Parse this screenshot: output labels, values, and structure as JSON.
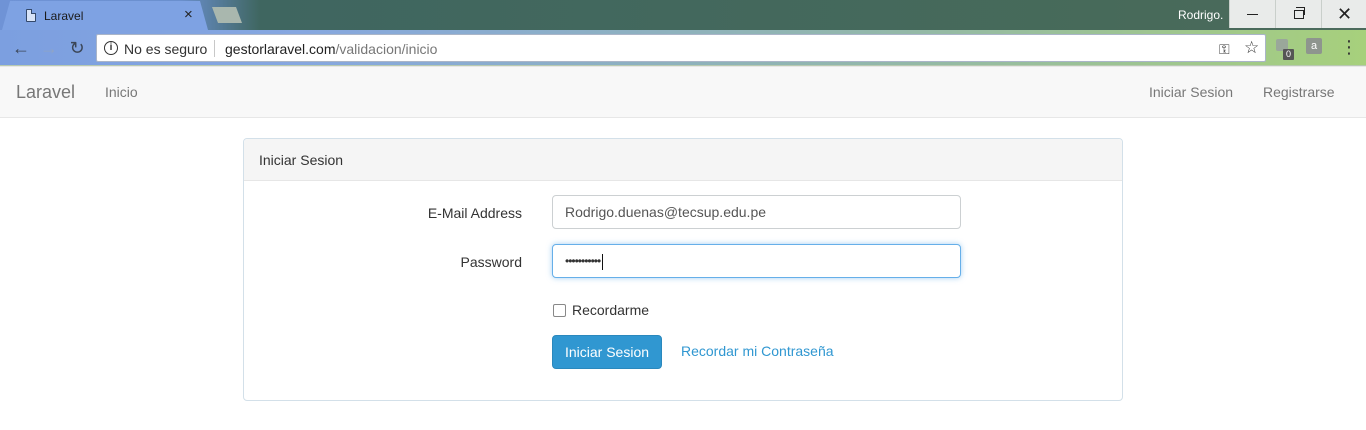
{
  "browser": {
    "tab_title": "Laravel",
    "tab_close": "×",
    "user_name": "Rodrigo.",
    "window_close": "✕",
    "security_text": "No es seguro",
    "url_host": "gestorlaravel.com",
    "url_path": "/validacion/inicio",
    "extension_badge": "0",
    "extension2_label": "a",
    "icons": {
      "back": "←",
      "forward": "→",
      "reload": "↻",
      "info": "i",
      "key": "⚿",
      "star": "☆",
      "menu": "⋮"
    }
  },
  "navbar": {
    "brand": "Laravel",
    "home": "Inicio",
    "login": "Iniciar Sesion",
    "register": "Registrarse"
  },
  "login_panel": {
    "heading": "Iniciar Sesion",
    "email_label": "E-Mail Address",
    "email_value": "Rodrigo.duenas@tecsup.edu.pe",
    "password_label": "Password",
    "password_masked": "•••••••••••",
    "remember_label": "Recordarme",
    "remember_checked": false,
    "submit_label": "Iniciar Sesion",
    "forgot_link": "Recordar mi Contraseña"
  },
  "colors": {
    "primary": "#3097d1",
    "navbar_bg": "#f8f8f8",
    "focus_border": "#66afe9"
  }
}
